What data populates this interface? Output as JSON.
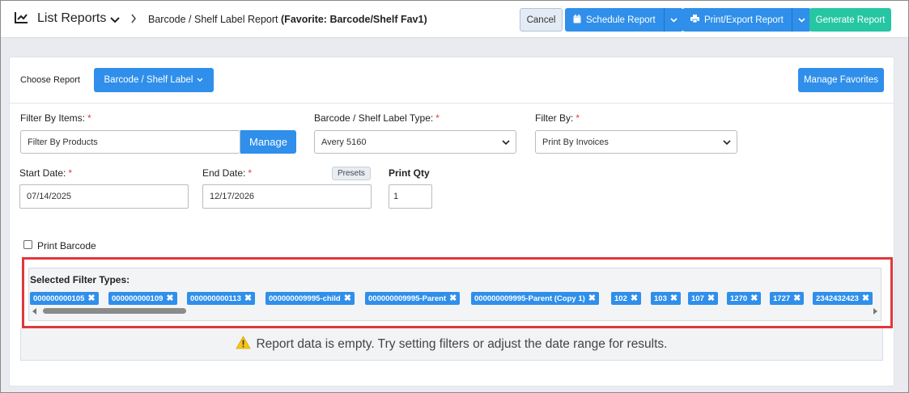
{
  "header": {
    "title": "List Reports",
    "page_prefix": "Barcode / Shelf Label Report",
    "page_favorite": "(Favorite: Barcode/Shelf Fav1)"
  },
  "toolbar": {
    "cancel_label": "Cancel",
    "schedule_label": "Schedule Report",
    "print_label": "Print/Export Report",
    "generate_label": "Generate Report"
  },
  "choose": {
    "label": "Choose Report",
    "selected": "Barcode / Shelf Label",
    "manage_favorites": "Manage Favorites"
  },
  "filters": {
    "items_label": "Filter By Items:",
    "items_value": "Filter By Products",
    "manage_label": "Manage",
    "type_label": "Barcode / Shelf Label Type:",
    "type_value": "Avery 5160",
    "by_label": "Filter By:",
    "by_value": "Print By Invoices",
    "start_label": "Start Date:",
    "start_value": "07/14/2025",
    "end_label": "End Date:",
    "end_value": "12/17/2026",
    "presets_label": "Presets",
    "qty_label": "Print Qty",
    "qty_value": "1",
    "print_barcode_label": "Print Barcode",
    "required_mark": "*"
  },
  "selected_filters": {
    "title": "Selected Filter Types:",
    "chips": [
      "000000000105",
      "000000000109",
      "000000000113",
      "000000009995-child",
      "000000009995-Parent",
      "000000009995-Parent (Copy 1)",
      "102",
      "103",
      "107",
      "1270",
      "1727",
      "2342432423"
    ]
  },
  "empty_message": "Report data is empty. Try setting filters or adjust the date range for results.",
  "colors": {
    "primary": "#2f8fea",
    "success": "#26c6a2",
    "highlight": "#e0383d",
    "warning": "#f5c518"
  }
}
